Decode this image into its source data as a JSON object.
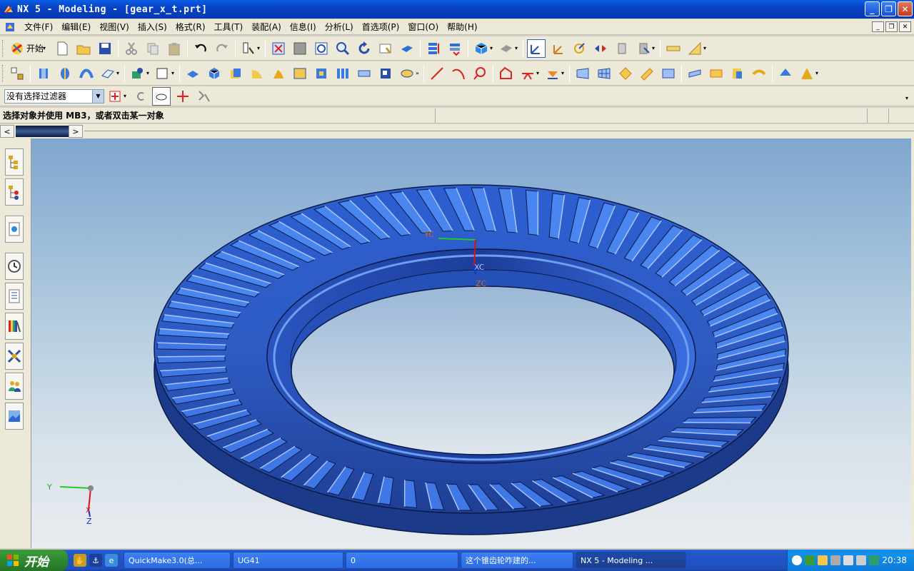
{
  "window": {
    "title": "NX 5 - Modeling - [gear_x_t.prt]"
  },
  "menu": {
    "items": [
      "文件(F)",
      "编辑(E)",
      "视图(V)",
      "插入(S)",
      "格式(R)",
      "工具(T)",
      "装配(A)",
      "信息(I)",
      "分析(L)",
      "首选项(P)",
      "窗口(O)",
      "帮助(H)"
    ]
  },
  "toolbar": {
    "start_label": "开始"
  },
  "filter": {
    "value": "没有选择过滤器"
  },
  "cue": {
    "text": "选择对象并使用 MB3，或者双击某一对象"
  },
  "viewport": {
    "wcs": {
      "yc": "YC",
      "xc": "XC",
      "zc": "ZC"
    },
    "triad": {
      "y": "Y",
      "x": "X",
      "z": "Z"
    },
    "model_color": "#2f5fc8"
  },
  "taskbar": {
    "start_label": "开始",
    "tasks": [
      "QuickMake3.0(总...",
      "UG41",
      "0",
      "这个锥齿轮咋建的...",
      "NX 5 - Modeling ..."
    ],
    "clock": "20:38"
  }
}
